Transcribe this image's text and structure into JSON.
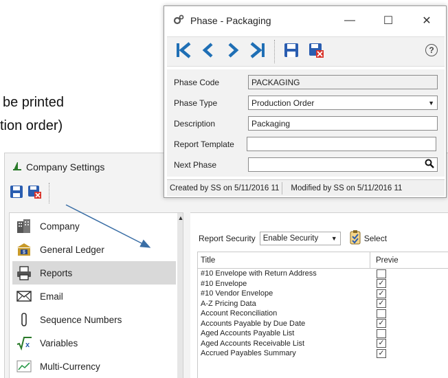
{
  "background": {
    "caption_line1": "be printed",
    "caption_line2": "tion order)"
  },
  "company_settings": {
    "title": "Company Settings",
    "title_icon": "company-settings-icon",
    "toolbar": {
      "save_icon": "save-icon",
      "cancel_icon": "save-cancel-icon"
    },
    "sidebar": {
      "items": [
        {
          "label": "Company",
          "icon": "building-icon"
        },
        {
          "label": "General Ledger",
          "icon": "bank-icon"
        },
        {
          "label": "Reports",
          "icon": "printer-icon"
        },
        {
          "label": "Email",
          "icon": "envelope-icon"
        },
        {
          "label": "Sequence Numbers",
          "icon": "paperclip-icon"
        },
        {
          "label": "Variables",
          "icon": "sqrt-icon"
        },
        {
          "label": "Multi-Currency",
          "icon": "currency-chart-icon"
        }
      ],
      "active_index": 2
    },
    "reports": {
      "security_label": "Report Security",
      "security_value": "Enable Security",
      "select_all_label": "Select",
      "columns": [
        "Title",
        "Previe"
      ],
      "rows": [
        {
          "title": "#10 Envelope with Return Address",
          "checked": false
        },
        {
          "title": "#10 Envelope",
          "checked": true
        },
        {
          "title": "#10 Vendor Envelope",
          "checked": true
        },
        {
          "title": "A-Z Pricing Data",
          "checked": true
        },
        {
          "title": "Account Reconciliation",
          "checked": false
        },
        {
          "title": "Accounts Payable by Due Date",
          "checked": true
        },
        {
          "title": "Aged Accounts Payable List",
          "checked": false
        },
        {
          "title": "Aged Accounts Receivable List",
          "checked": true
        },
        {
          "title": "Accrued Payables Summary",
          "checked": true
        }
      ]
    }
  },
  "phase_window": {
    "title": "Phase - Packaging",
    "controls": {
      "minimize": "—",
      "maximize": "☐",
      "close": "✕"
    },
    "help": "?",
    "fields": {
      "phase_code_label": "Phase Code",
      "phase_code_value": "PACKAGING",
      "phase_type_label": "Phase Type",
      "phase_type_value": "Production Order",
      "description_label": "Description",
      "description_value": "Packaging",
      "report_template_label": "Report Template",
      "report_template_value": "",
      "next_phase_label": "Next Phase",
      "next_phase_value": ""
    },
    "status": {
      "created": "Created by SS on 5/11/2016 11",
      "modified": "Modified by SS on 5/11/2016 11"
    }
  },
  "colors": {
    "nav_blue": "#1f6fb5",
    "save_blue": "#2a5db0",
    "cancel_red": "#d9342b",
    "arrow_blue": "#3a6ea5"
  }
}
